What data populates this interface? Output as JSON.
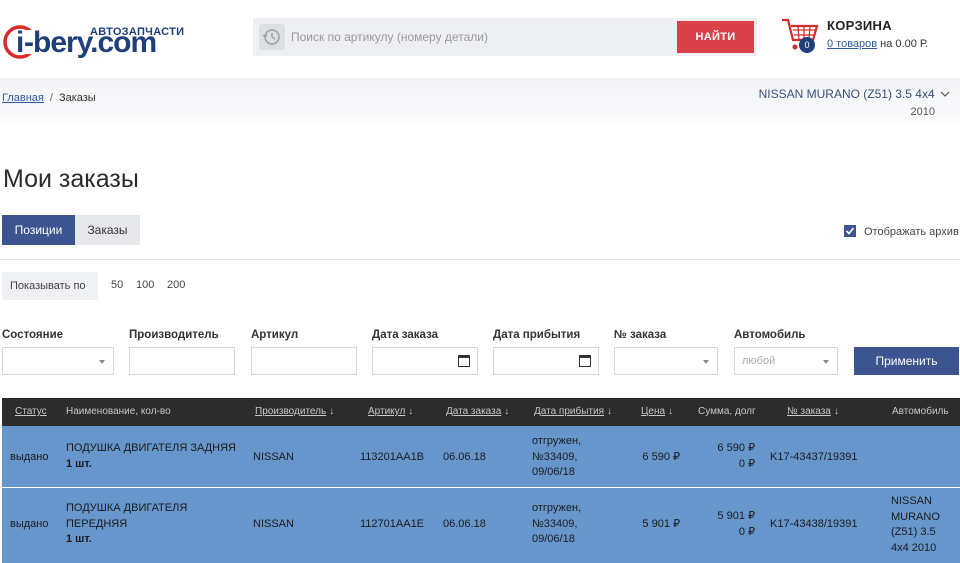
{
  "header": {
    "logo_sub": "АВТОЗАПЧАСТИ",
    "logo_i": "i",
    "logo_rest": "-bery.com",
    "search_placeholder": "Поиск по артикулу (номеру детали)",
    "search_button": "НАЙТИ",
    "cart_title": "КОРЗИНА",
    "cart_count": "0",
    "cart_items_link": "0 товаров",
    "cart_amount": " на 0.00 Р."
  },
  "breadcrumb": {
    "home": "Главная",
    "separator": "/",
    "current": "Заказы"
  },
  "vehicle": {
    "name": "NISSAN MURANO (Z51) 3.5 4x4",
    "year": "2010"
  },
  "page_title": "Мои заказы",
  "tabs": [
    {
      "label": "Позиции",
      "active": true
    },
    {
      "label": "Заказы",
      "active": false
    }
  ],
  "archive_label": "Отображать архив",
  "archive_checked": true,
  "per_page": {
    "label": "Показывать по",
    "options": [
      "50",
      "100",
      "200"
    ]
  },
  "filters": {
    "state": "Состояние",
    "manufacturer": "Производитель",
    "article": "Артикул",
    "order_date": "Дата заказа",
    "arrival_date": "Дата прибытия",
    "order_no": "№ заказа",
    "car": "Автомобиль",
    "car_placeholder": "любой",
    "apply": "Применить"
  },
  "table": {
    "columns": {
      "status": "Статус",
      "name": "Наименование, кол-во",
      "manufacturer": "Производитель",
      "article": "Артикул",
      "order_date": "Дата заказа",
      "arrival_date": "Дата прибытия",
      "price": "Цена",
      "sum_debt": "Сумма, долг",
      "order_no": "№ заказа",
      "car": "Автомобиль"
    },
    "sort_arrow": "↓",
    "rows": [
      {
        "status": "выдано",
        "name_line1": "ПОДУШКА ДВИГАТЕЛЯ ЗАДНЯЯ",
        "name_line2": "",
        "qty": "1 шт.",
        "manufacturer": "NISSAN",
        "article": "113201AA1B",
        "order_date": "06.06.18",
        "arrival_line1": "отгружен,",
        "arrival_line2": "№33409,",
        "arrival_line3": "09/06/18",
        "price": "6 590 ₽",
        "sum": "6 590 ₽",
        "debt": "0 ₽",
        "order_no": "K17-43437/19391",
        "car_line1": "",
        "car_line2": "",
        "car_line3": "",
        "car_line4": ""
      },
      {
        "status": "выдано",
        "name_line1": "ПОДУШКА ДВИГАТЕЛЯ",
        "name_line2": "ПЕРЕДНЯЯ",
        "qty": "1 шт.",
        "manufacturer": "NISSAN",
        "article": "112701AA1E",
        "order_date": "06.06.18",
        "arrival_line1": "отгружен,",
        "arrival_line2": "№33409,",
        "arrival_line3": "09/06/18",
        "price": "5 901 ₽",
        "sum": "5 901 ₽",
        "debt": "0 ₽",
        "order_no": "K17-43438/19391",
        "car_line1": "NISSAN",
        "car_line2": "MURANO",
        "car_line3": "(Z51) 3.5",
        "car_line4": "4x4 2010"
      }
    ]
  },
  "colors": {
    "primary": "#3c5490",
    "search_button": "#d9424a",
    "row_bg": "#6696cc",
    "table_header": "#2c2c2c"
  }
}
